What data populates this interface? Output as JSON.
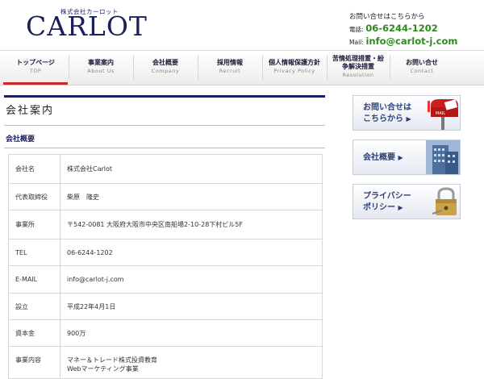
{
  "header": {
    "company_sub": "株式会社カーロット",
    "logo": "CARLOT",
    "contact_heading": "お問い合せはこちらから",
    "phone_label": "電話:",
    "phone": "06-6244-1202",
    "mail_label": "Mail:",
    "email": "info@carlot-j.com"
  },
  "nav": [
    {
      "jp": "トップページ",
      "en": "TOP"
    },
    {
      "jp": "事業案内",
      "en": "About Us"
    },
    {
      "jp": "会社概要",
      "en": "Company"
    },
    {
      "jp": "採用情報",
      "en": "Recruit"
    },
    {
      "jp": "個人情報保護方針",
      "en": "Privacy Policy"
    },
    {
      "jp": "苦情処理措置・紛争解決措置",
      "en": "Resolution"
    },
    {
      "jp": "お問い合せ",
      "en": "Contact"
    }
  ],
  "main": {
    "page_title": "会社案内",
    "section_title": "会社概要",
    "rows": [
      {
        "key": "会社名",
        "value": "株式会社Carlot"
      },
      {
        "key": "代表取締役",
        "value": "柴原　隆史"
      },
      {
        "key": "事業所",
        "value": "〒542-0081 大阪府大阪市中央区南船場2-10-28下村ビル5F"
      },
      {
        "key": "TEL",
        "value": "06-6244-1202"
      },
      {
        "key": "E-MAIL",
        "value": "info@carlot-j.com"
      },
      {
        "key": "設立",
        "value": "平成22年4月1日"
      },
      {
        "key": "資本金",
        "value": "900万"
      },
      {
        "key": "事業内容",
        "value": "マネー＆トレード株式投資教育",
        "value2": "Webマーケティング事業"
      }
    ]
  },
  "sidebar": {
    "contact_line1": "お問い合せは",
    "contact_line2": "こちらから",
    "mail_box_label": "MAIL",
    "company": "会社概要",
    "privacy_line1": "プライバシー",
    "privacy_line2": "ポリシー"
  },
  "colors": {
    "brand": "#1b1f5c",
    "accent_green": "#2d8a1c",
    "active_red": "#c8272c"
  }
}
